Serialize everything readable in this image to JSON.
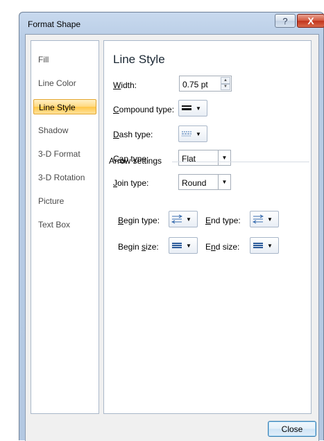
{
  "window": {
    "title": "Format Shape",
    "help_label": "?",
    "close_label": "X"
  },
  "nav": {
    "items": [
      {
        "label": "Fill"
      },
      {
        "label": "Line Color"
      },
      {
        "label": "Line Style",
        "selected": true
      },
      {
        "label": "Shadow"
      },
      {
        "label": "3-D Format"
      },
      {
        "label": "3-D Rotation"
      },
      {
        "label": "Picture"
      },
      {
        "label": "Text Box"
      }
    ]
  },
  "panel": {
    "heading": "Line Style",
    "width": {
      "label_u": "W",
      "label_rest": "idth:",
      "value": "0.75 pt"
    },
    "compound": {
      "label_u": "C",
      "label_rest": "ompound type:"
    },
    "dash": {
      "label_u": "D",
      "label_rest": "ash type:"
    },
    "cap": {
      "label_pre": "C",
      "label_u": "a",
      "label_rest": "p type:",
      "value": "Flat"
    },
    "join": {
      "label_u": "J",
      "label_rest": "oin type:",
      "value": "Round"
    },
    "arrow_settings": "Arrow settings",
    "begin_type": {
      "label_u": "B",
      "label_rest": "egin type:"
    },
    "end_type": {
      "label_u": "E",
      "label_rest": "nd type:"
    },
    "begin_size": {
      "label_pre": "Begin ",
      "label_u": "s",
      "label_rest": "ize:"
    },
    "end_size": {
      "label_pre": "E",
      "label_u": "n",
      "label_rest": "d size:"
    }
  },
  "footer": {
    "close_label": "Close"
  },
  "colors": {
    "selected_bg": "#ffd87f",
    "selected_border": "#e3a62f",
    "title_bar": "#c8d9ee"
  },
  "icons": [
    "help-icon",
    "close-icon",
    "compound-type-icon",
    "dash-type-icon",
    "arrow-type-icon",
    "arrow-size-icon"
  ]
}
